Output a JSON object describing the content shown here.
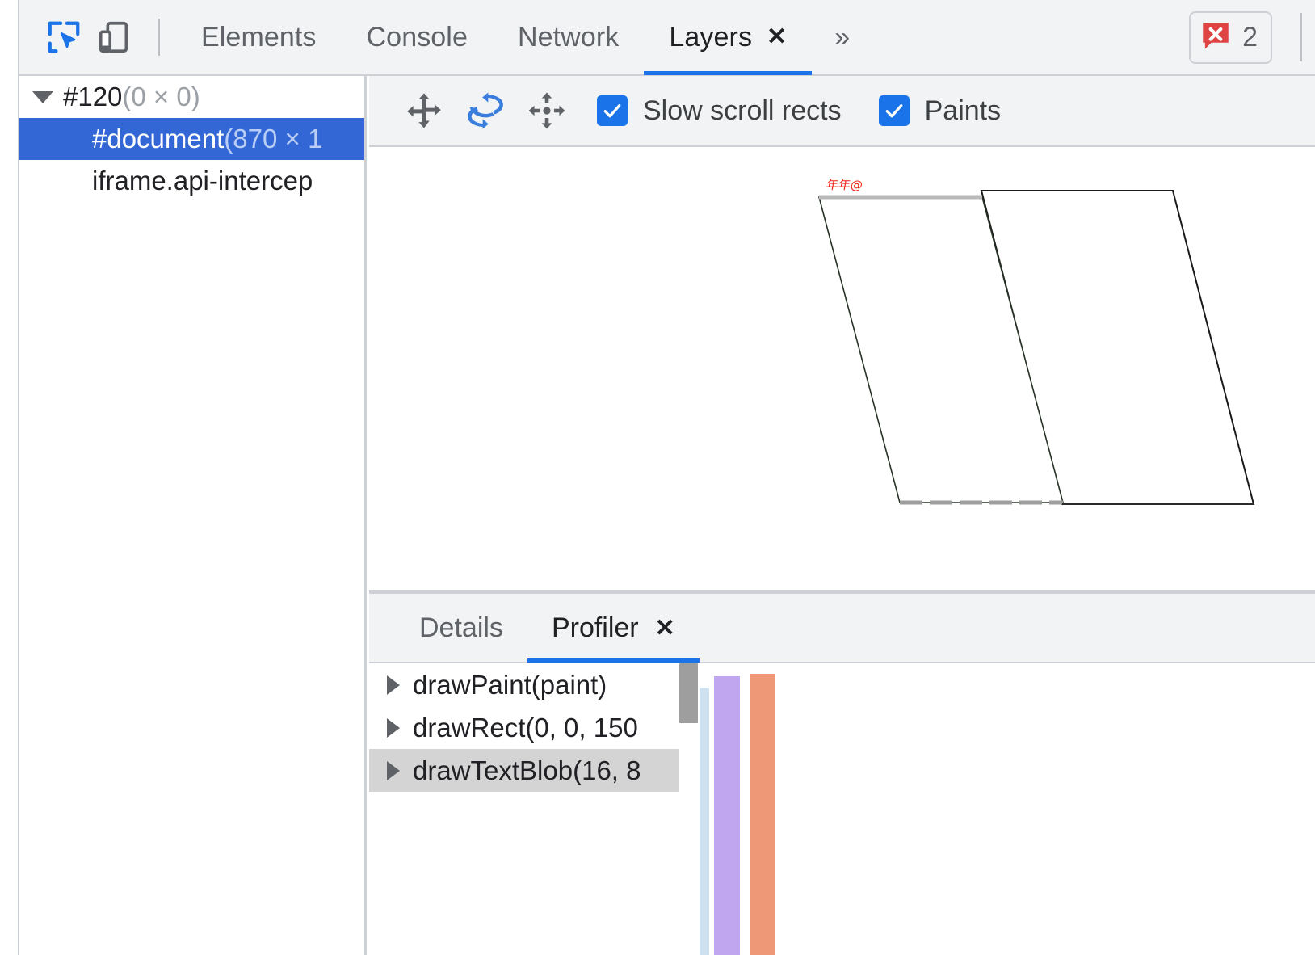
{
  "toolbar": {
    "inspect_icon": "inspect-element-icon",
    "device_icon": "device-toolbar-icon"
  },
  "tabs": [
    {
      "label": "Elements",
      "active": false,
      "closable": false
    },
    {
      "label": "Console",
      "active": false,
      "closable": false
    },
    {
      "label": "Network",
      "active": false,
      "closable": false
    },
    {
      "label": "Layers",
      "active": true,
      "closable": true
    }
  ],
  "more_tabs_label": "»",
  "close_glyph": "✕",
  "error_badge": {
    "count": "2",
    "icon": "error-bubble-icon",
    "color": "#e04343"
  },
  "sidebar": {
    "rows": [
      {
        "name": "#120",
        "size": "(0 × 0)",
        "depth": 0,
        "expanded": true,
        "selected": false
      },
      {
        "name": "#document",
        "size": "(870 × 1",
        "depth": 1,
        "expanded": false,
        "selected": true
      },
      {
        "name": "iframe.api-intercep",
        "size": "",
        "depth": 1,
        "expanded": false,
        "selected": false
      }
    ]
  },
  "view_toolbar": {
    "icons": [
      {
        "name": "pan-mode-icon",
        "active": false
      },
      {
        "name": "rotate-mode-icon",
        "active": true
      },
      {
        "name": "reset-view-icon",
        "active": false
      }
    ],
    "checkboxes": [
      {
        "label": "Slow scroll rects",
        "checked": true
      },
      {
        "label": "Paints",
        "checked": true
      }
    ]
  },
  "canvas": {
    "layers": [
      {
        "name": "layer-document",
        "text": "年年@"
      },
      {
        "name": "layer-iframe",
        "text": ""
      }
    ]
  },
  "drawer": {
    "tabs": [
      {
        "label": "Details",
        "active": false,
        "closable": false
      },
      {
        "label": "Profiler",
        "active": true,
        "closable": true
      }
    ],
    "log_rows": [
      {
        "label": "drawPaint(paint)",
        "selected": false
      },
      {
        "label": "drawRect(0, 0, 150",
        "selected": false
      },
      {
        "label": "drawTextBlob(16, 8",
        "selected": true
      }
    ]
  },
  "chart_data": {
    "type": "bar",
    "title": "Paint profiler command timings",
    "categories": [
      "drawPaint",
      "drawRect",
      "drawTextBlob"
    ],
    "values": [
      0,
      80,
      88
    ],
    "colors": [
      "#cfe0ef",
      "#c0a6ef",
      "#ef9878"
    ],
    "xlabel": "",
    "ylabel": "",
    "grid": false,
    "legend": "none"
  },
  "colors": {
    "accent": "#1a73e8",
    "selection": "#3367d6",
    "chrome_bg": "#f1f3f4",
    "border": "#cdd0d4",
    "text": "#202124",
    "muted": "#5f6368",
    "layer_text": "#ee2211",
    "error": "#e04343"
  }
}
